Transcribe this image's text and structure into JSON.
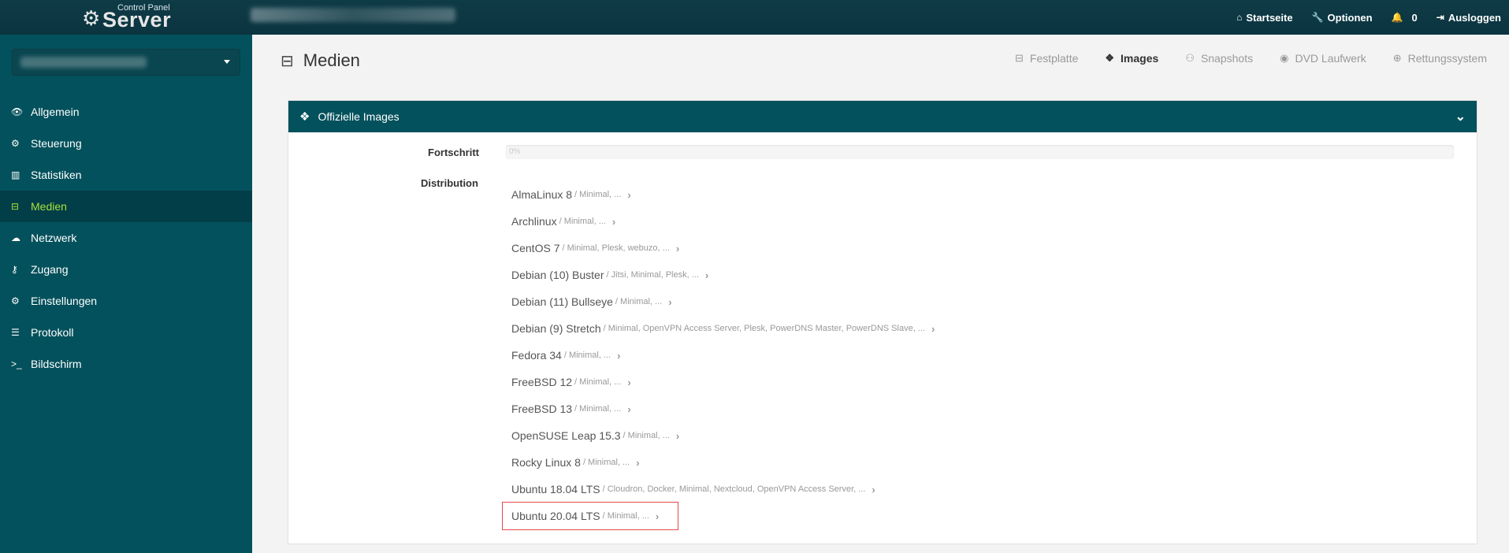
{
  "brand": {
    "small": "Control Panel",
    "big": "Server"
  },
  "topnav": {
    "home": "Startseite",
    "options": "Optionen",
    "notifications_count": "0",
    "logout": "Ausloggen"
  },
  "sidebar": {
    "items": [
      {
        "label": "Allgemein",
        "icon": "eye-icon"
      },
      {
        "label": "Steuerung",
        "icon": "gear-icon"
      },
      {
        "label": "Statistiken",
        "icon": "bar-chart-icon"
      },
      {
        "label": "Medien",
        "icon": "drive-icon",
        "active": true
      },
      {
        "label": "Netzwerk",
        "icon": "cloud-icon"
      },
      {
        "label": "Zugang",
        "icon": "key-icon"
      },
      {
        "label": "Einstellungen",
        "icon": "gears-icon"
      },
      {
        "label": "Protokoll",
        "icon": "list-icon"
      },
      {
        "label": "Bildschirm",
        "icon": "terminal-icon"
      }
    ]
  },
  "page": {
    "title": "Medien",
    "tabs": [
      {
        "label": "Festplatte"
      },
      {
        "label": "Images",
        "active": true
      },
      {
        "label": "Snapshots"
      },
      {
        "label": "DVD Laufwerk"
      },
      {
        "label": "Rettungssystem"
      }
    ]
  },
  "panel": {
    "title": "Offizielle Images",
    "progress_label": "Fortschritt",
    "progress_value": "0%",
    "distribution_label": "Distribution",
    "distributions": [
      {
        "name": "AlmaLinux 8",
        "variants": "/ Minimal, ..."
      },
      {
        "name": "Archlinux",
        "variants": "/ Minimal, ..."
      },
      {
        "name": "CentOS 7",
        "variants": "/ Minimal, Plesk, webuzo, ..."
      },
      {
        "name": "Debian (10) Buster",
        "variants": "/ Jitsi, Minimal, Plesk, ..."
      },
      {
        "name": "Debian (11) Bullseye",
        "variants": "/ Minimal, ..."
      },
      {
        "name": "Debian (9) Stretch",
        "variants": "/ Minimal, OpenVPN Access Server, Plesk, PowerDNS Master, PowerDNS Slave, ..."
      },
      {
        "name": "Fedora 34",
        "variants": "/ Minimal, ..."
      },
      {
        "name": "FreeBSD 12",
        "variants": "/ Minimal, ..."
      },
      {
        "name": "FreeBSD 13",
        "variants": "/ Minimal, ..."
      },
      {
        "name": "OpenSUSE Leap 15.3",
        "variants": "/ Minimal, ..."
      },
      {
        "name": "Rocky Linux 8",
        "variants": "/ Minimal, ..."
      },
      {
        "name": "Ubuntu 18.04 LTS",
        "variants": "/ Cloudron, Docker, Minimal, Nextcloud, OpenVPN Access Server, ..."
      },
      {
        "name": "Ubuntu 20.04 LTS",
        "variants": "/ Minimal, ..."
      }
    ]
  }
}
